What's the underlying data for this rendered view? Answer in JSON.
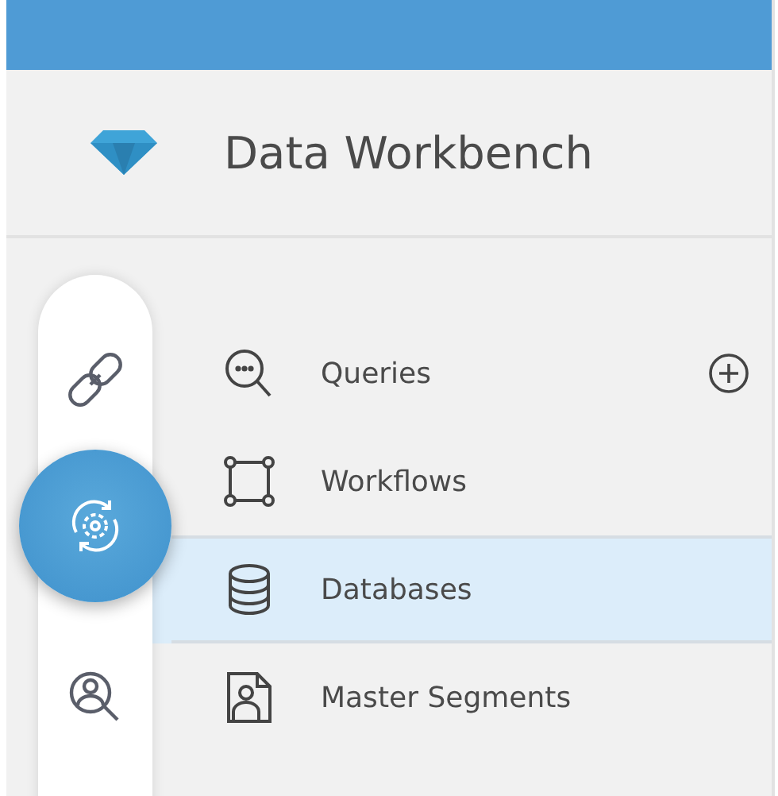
{
  "header": {
    "title": "Data Workbench"
  },
  "rail": [
    {
      "kind": "link",
      "selected": false
    },
    {
      "kind": "gear-sync",
      "selected": true
    },
    {
      "kind": "person-search",
      "selected": false
    }
  ],
  "menu": [
    {
      "kind": "queries",
      "label": "Queries",
      "add": true,
      "selected": false
    },
    {
      "kind": "workflows",
      "label": "Workflows",
      "add": false,
      "selected": false
    },
    {
      "kind": "databases",
      "label": "Databases",
      "add": false,
      "selected": true
    },
    {
      "kind": "segments",
      "label": "Master Segments",
      "add": false,
      "selected": false
    }
  ]
}
